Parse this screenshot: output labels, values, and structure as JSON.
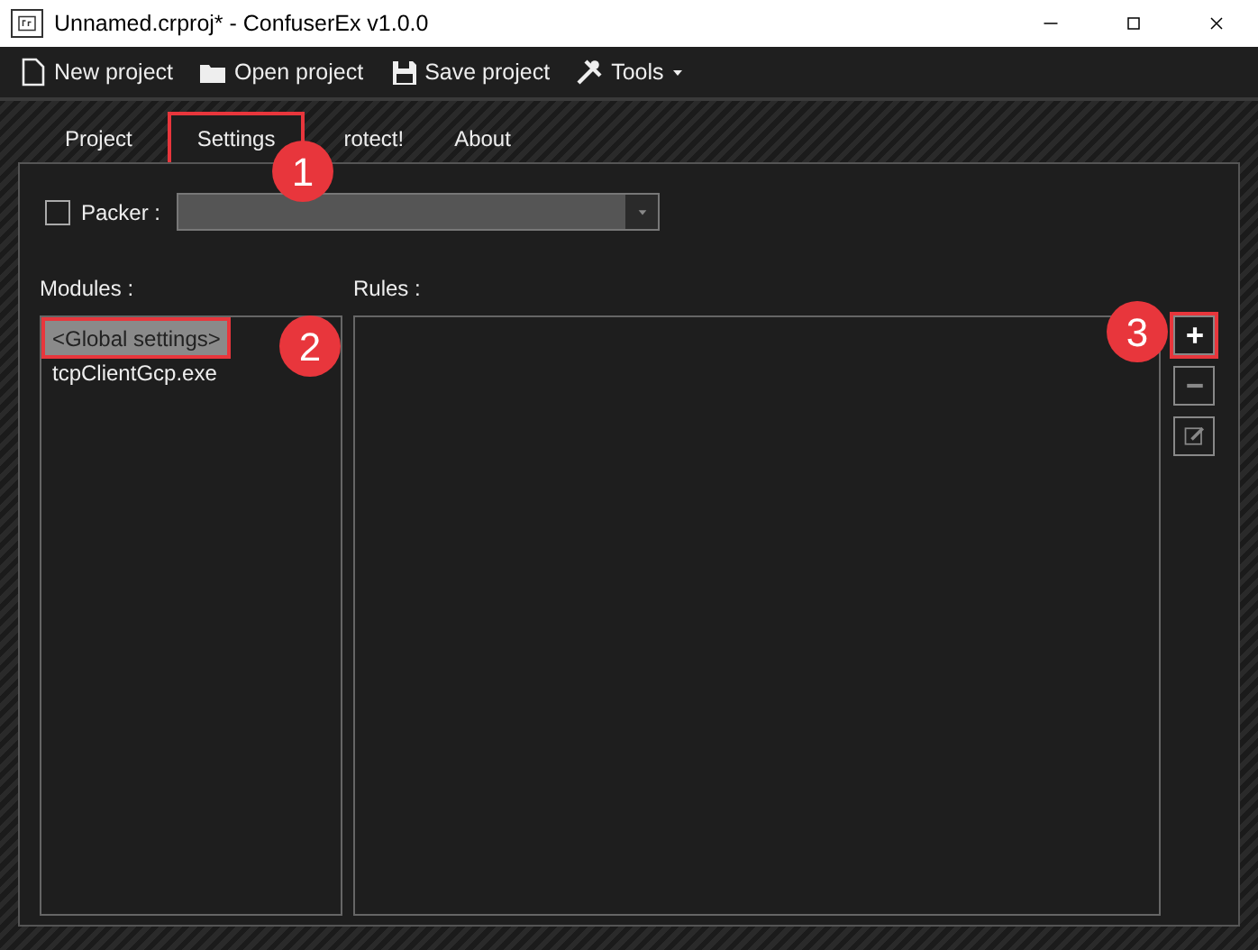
{
  "window": {
    "title": "Unnamed.crproj* - ConfuserEx v1.0.0"
  },
  "toolbar": [
    {
      "label": "New project"
    },
    {
      "label": "Open project"
    },
    {
      "label": "Save project"
    },
    {
      "label": "Tools",
      "dropdown": true
    }
  ],
  "tabs": [
    {
      "label": "Project",
      "selected": false,
      "highlighted": false
    },
    {
      "label": "Settings",
      "selected": true,
      "highlighted": true
    },
    {
      "label": "rotect!",
      "selected": false,
      "highlighted": false
    },
    {
      "label": "About",
      "selected": false,
      "highlighted": false
    }
  ],
  "packer": {
    "label": "Packer :",
    "checked": false
  },
  "modules": {
    "label": "Modules :",
    "items": [
      {
        "label": "<Global settings>",
        "selected": true,
        "highlighted": true
      },
      {
        "label": "tcpClientGcp.exe",
        "selected": false,
        "highlighted": false
      }
    ]
  },
  "rules": {
    "label": "Rules :",
    "buttons": [
      {
        "kind": "add",
        "highlighted": true
      },
      {
        "kind": "remove",
        "highlighted": false
      },
      {
        "kind": "edit",
        "highlighted": false
      }
    ]
  },
  "callouts": [
    {
      "label": "1"
    },
    {
      "label": "2"
    },
    {
      "label": "3"
    }
  ]
}
